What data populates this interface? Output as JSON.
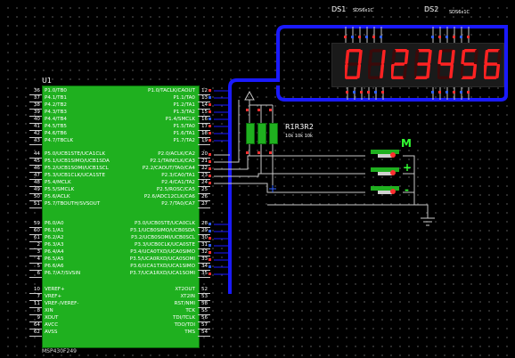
{
  "schematic": {
    "mcu_ref": "U1",
    "mcu_part": "MSP430F249",
    "left_pins": [
      {
        "num": "36",
        "name": "P1.0/TB0"
      },
      {
        "num": "37",
        "name": "P4.1/TB1"
      },
      {
        "num": "38",
        "name": "P4.2/TB2"
      },
      {
        "num": "39",
        "name": "P4.3/TB3"
      },
      {
        "num": "40",
        "name": "P4.4/TB4"
      },
      {
        "num": "41",
        "name": "P4.5/TB5"
      },
      {
        "num": "42",
        "name": "P4.6/TB6"
      },
      {
        "num": "43",
        "name": "P4.7/TBCLK"
      },
      {
        "num": "44",
        "name": "P5.0/UCB1STE/UCA1CLK"
      },
      {
        "num": "45",
        "name": "P5.1/UCB1SIMO/UCB1SDA"
      },
      {
        "num": "46",
        "name": "P5.2/UCB1SOMI/UCB1SCL"
      },
      {
        "num": "47",
        "name": "P5.3/UCB1CLK/UCA1STE"
      },
      {
        "num": "48",
        "name": "P5.4/MCLK"
      },
      {
        "num": "49",
        "name": "P5.5/SMCLK"
      },
      {
        "num": "50",
        "name": "P5.6/ACLK"
      },
      {
        "num": "51",
        "name": "P5.7/TBOUTH/SVSOUT"
      },
      {
        "num": "59",
        "name": "P6.0/A0"
      },
      {
        "num": "60",
        "name": "P6.1/A1"
      },
      {
        "num": "61",
        "name": "P6.2/A2"
      },
      {
        "num": "2",
        "name": "P6.3/A3"
      },
      {
        "num": "3",
        "name": "P6.4/A4"
      },
      {
        "num": "4",
        "name": "P6.5/A5"
      },
      {
        "num": "5",
        "name": "P6.6/A6"
      },
      {
        "num": "6",
        "name": "P6.7/A7/SVSIN"
      },
      {
        "num": "10",
        "name": "VEREF+"
      },
      {
        "num": "7",
        "name": "VREF+"
      },
      {
        "num": "11",
        "name": "VREF-/VEREF-"
      },
      {
        "num": "8",
        "name": "XIN"
      },
      {
        "num": "9",
        "name": "XOUT"
      },
      {
        "num": "64",
        "name": "AVCC"
      },
      {
        "num": "62",
        "name": "AVSS"
      }
    ],
    "right_pins": [
      {
        "num": "12",
        "name": "P1.0/TACLK/CAOUT"
      },
      {
        "num": "13",
        "name": "P1.1/TA0"
      },
      {
        "num": "14",
        "name": "P1.2/TA1"
      },
      {
        "num": "15",
        "name": "P1.3/TA2"
      },
      {
        "num": "16",
        "name": "P1.4/SMCLK"
      },
      {
        "num": "17",
        "name": "P1.5/TA0"
      },
      {
        "num": "18",
        "name": "P1.6/TA1"
      },
      {
        "num": "19",
        "name": "P1.7/TA2"
      },
      {
        "num": "20",
        "name": "P2.0/ACLK/CA2"
      },
      {
        "num": "21",
        "name": "P2.1/TAINCLK/CA3"
      },
      {
        "num": "22",
        "name": "P2.2/CAOUT/TA0/CA4"
      },
      {
        "num": "23",
        "name": "P2.3/CA0/TA1"
      },
      {
        "num": "24",
        "name": "P2.4/CA1/TA2"
      },
      {
        "num": "25",
        "name": "P2.5/ROSC/CA5"
      },
      {
        "num": "26",
        "name": "P2.6/ADC12CLK/CA6"
      },
      {
        "num": "27",
        "name": "P2.7/TA0/CA7"
      },
      {
        "num": "28",
        "name": "P3.0/UCB0STE/UCA0CLK"
      },
      {
        "num": "29",
        "name": "P3.1/UCB0SIMO/UCB0SDA"
      },
      {
        "num": "30",
        "name": "P3.2/UCB0SOMI/UCB0SCL"
      },
      {
        "num": "31",
        "name": "P3.3/UCB0CLK/UCA0STE"
      },
      {
        "num": "32",
        "name": "P3.4/UCA0TXD/UCA0SIMO"
      },
      {
        "num": "33",
        "name": "P3.5/UCA0RXD/UCA0SOMI"
      },
      {
        "num": "34",
        "name": "P3.6/UCA1TXD/UCA1SIMO"
      },
      {
        "num": "35",
        "name": "P3.7/UCA1RXD/UCA1SOMI"
      },
      {
        "num": "52",
        "name": "XT2OUT"
      },
      {
        "num": "53",
        "name": "XT2IN"
      },
      {
        "num": "58",
        "name": "RST/NMI"
      },
      {
        "num": "55",
        "name": "TCK"
      },
      {
        "num": "56",
        "name": "TDI/TCLK"
      },
      {
        "num": "57",
        "name": "TDO/TDI"
      },
      {
        "num": "54",
        "name": "TMS"
      }
    ],
    "ds1_ref": "DS1",
    "ds1_part": "SDS6x1C",
    "ds2_ref": "DS2",
    "ds2_part": "SDS6x1C",
    "display_digits": [
      "0",
      "1",
      "2",
      "3",
      "4",
      "5",
      "6"
    ],
    "resistor_refs": "R1R3R2",
    "resistor_values": "10k  10k 10k",
    "button_label_m": "M",
    "button_label_plus": "+",
    "button_label_minus": "-",
    "colors": {
      "chip": "#1fb01f",
      "bus": "#1a1aff",
      "segment": "#ff2222",
      "wire": "#c8c8c8",
      "pin_red": "#ff3030"
    }
  }
}
